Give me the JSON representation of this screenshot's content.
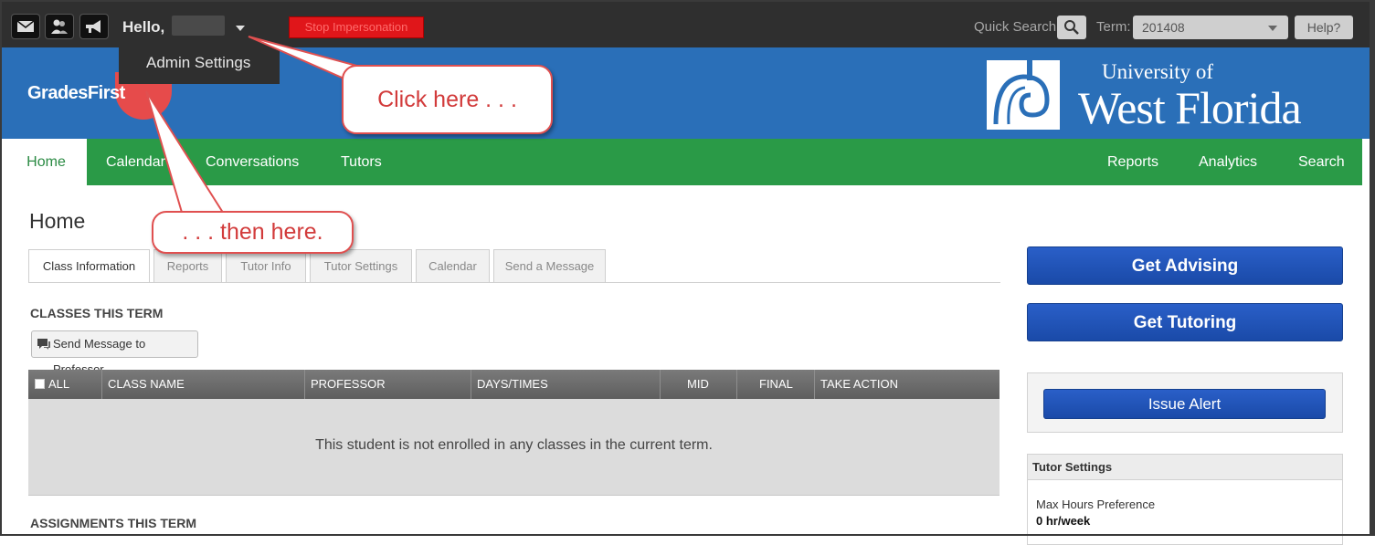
{
  "topbar": {
    "icons": [
      "mail-icon",
      "user-group-icon",
      "megaphone-icon"
    ],
    "hello": "Hello,",
    "stop_impersonating": "Stop Impersonation",
    "quick_search_label": "Quick Search:",
    "term_label": "Term:",
    "term_value": "201408",
    "help_label": "Help?"
  },
  "user_menu": {
    "items": [
      "Admin Settings"
    ]
  },
  "header": {
    "logo_text": "GradesFirst",
    "university_line1": "University of",
    "university_line2": "West Florida"
  },
  "nav": {
    "left": [
      "Home",
      "Calendar",
      "Conversations",
      "Tutors"
    ],
    "right": [
      "Reports",
      "Analytics",
      "Search"
    ],
    "active": "Home"
  },
  "page": {
    "title": "Home"
  },
  "tabs": [
    "Class Information",
    "Reports",
    "Tutor Info",
    "Tutor Settings",
    "Calendar",
    "Send a Message"
  ],
  "classes": {
    "heading": "CLASSES THIS TERM",
    "send_message_button": "Send Message to Professor",
    "columns": [
      "ALL",
      "CLASS NAME",
      "PROFESSOR",
      "DAYS/TIMES",
      "MID",
      "FINAL",
      "TAKE ACTION"
    ],
    "empty_message": "This student is not enrolled in any classes in the current term."
  },
  "assignments": {
    "heading": "ASSIGNMENTS THIS TERM"
  },
  "sidebar": {
    "get_advising": "Get Advising",
    "get_tutoring": "Get Tutoring",
    "issue_alert": "Issue Alert",
    "tutor_settings_title": "Tutor Settings",
    "max_hours_label": "Max Hours Preference",
    "max_hours_value": "0 hr/week"
  },
  "annotations": {
    "callout_1": "Click here . . .",
    "callout_2": ". . . then here."
  },
  "colors": {
    "topbar": "#2f2f2f",
    "header_blue": "#2a6fb8",
    "nav_green": "#2a9a47",
    "button_blue": "#1f52b4",
    "callout_red": "#d23b3b",
    "stop_red": "#e0161a"
  }
}
